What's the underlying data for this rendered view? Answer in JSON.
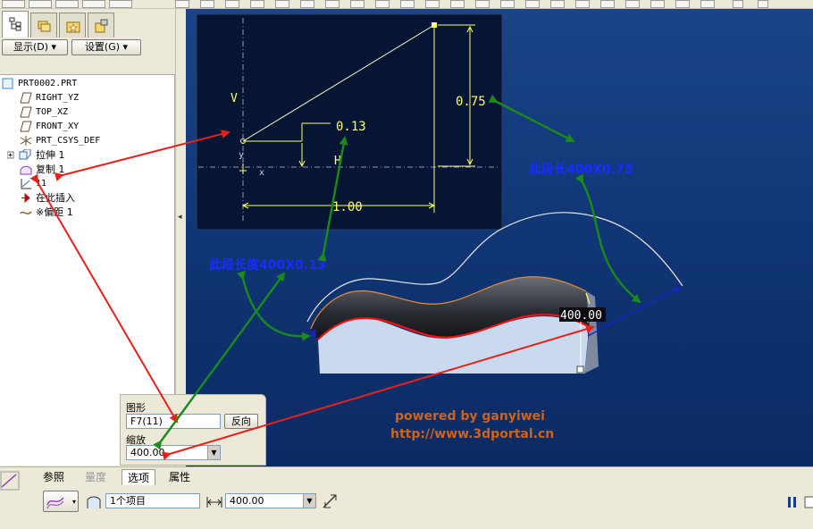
{
  "left_panel": {
    "show_button": "显示(D) ▾",
    "settings_button": "设置(G) ▾"
  },
  "tree": {
    "items": [
      {
        "label": "PRT0002.PRT",
        "icon": "part-icon"
      },
      {
        "label": "RIGHT_YZ",
        "icon": "datum-plane-icon"
      },
      {
        "label": "TOP_XZ",
        "icon": "datum-plane-icon"
      },
      {
        "label": "FRONT_XY",
        "icon": "datum-plane-icon"
      },
      {
        "label": "PRT_CSYS_DEF",
        "icon": "csys-icon"
      },
      {
        "label": "拉伸 1",
        "icon": "extrude-icon"
      },
      {
        "label": "复制 1",
        "icon": "copy-surface-icon"
      },
      {
        "label": "11",
        "icon": "graph-icon"
      },
      {
        "label": "在此插入",
        "icon": "insert-here-icon"
      },
      {
        "label": "※偏距 1",
        "icon": "offset-icon"
      }
    ]
  },
  "graph_sketch": {
    "v_label": "V",
    "h_label": "H",
    "dim_013": "0.13",
    "dim_075": "0.75",
    "dim_100": "1.00",
    "y_axis": "y",
    "x_axis": "x"
  },
  "annotations": {
    "segment_0013": "此段长度400X0.13",
    "segment_0075": "此段长400X0.75",
    "dimension": "400.00",
    "powered_by": "powered by ganyiwei",
    "url": "http://www.3dportal.cn"
  },
  "options_popup": {
    "graph_label": "图形",
    "graph_value": "F7(11)",
    "reverse_button": "反向",
    "scale_label": "缩放",
    "scale_value": "400.00"
  },
  "dashboard": {
    "tabs": [
      "参照",
      "量度",
      "选项",
      "属性"
    ],
    "active_tab": "选项",
    "items_field": "1个项目",
    "distance_value": "400.00"
  },
  "colors": {
    "viewport_top": "#1a4487",
    "annotation_blue": "#1a2cff",
    "watermark": "#d0621a",
    "sketch_yellow": "#ffff66",
    "arrow_red": "#e8201a",
    "arrow_green": "#1b8a1b"
  }
}
